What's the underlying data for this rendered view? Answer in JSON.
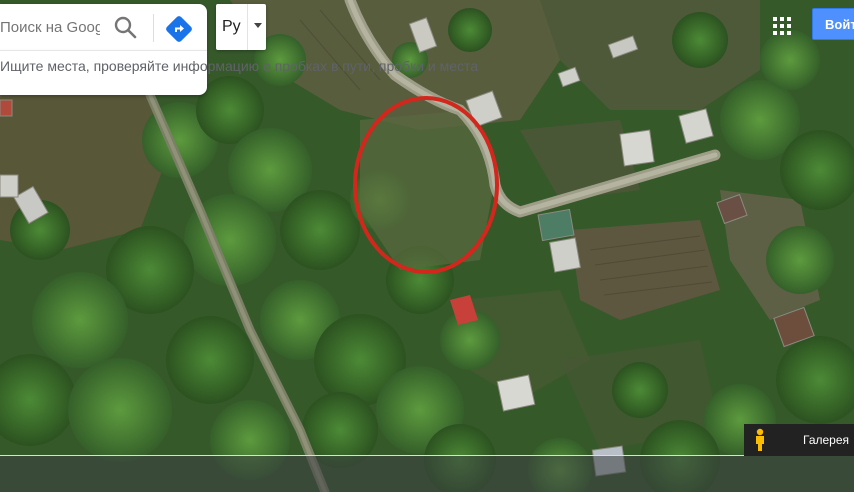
{
  "search": {
    "placeholder": "Поиск на Google Картах",
    "hint": "Ищите места, проверяйте информацию о пробках в пути, пробки и места"
  },
  "language": {
    "selected": "Ру"
  },
  "header": {
    "signin_label": "Войти"
  },
  "bottom": {
    "gallery_label": "Галерея"
  },
  "colors": {
    "signin": "#4d90fe",
    "directions": "#1a73e8",
    "marker_ring": "#d3261c"
  },
  "icons": {
    "search": "search-icon",
    "directions": "directions-icon",
    "apps": "apps-grid-icon",
    "pegman": "pegman-icon"
  }
}
